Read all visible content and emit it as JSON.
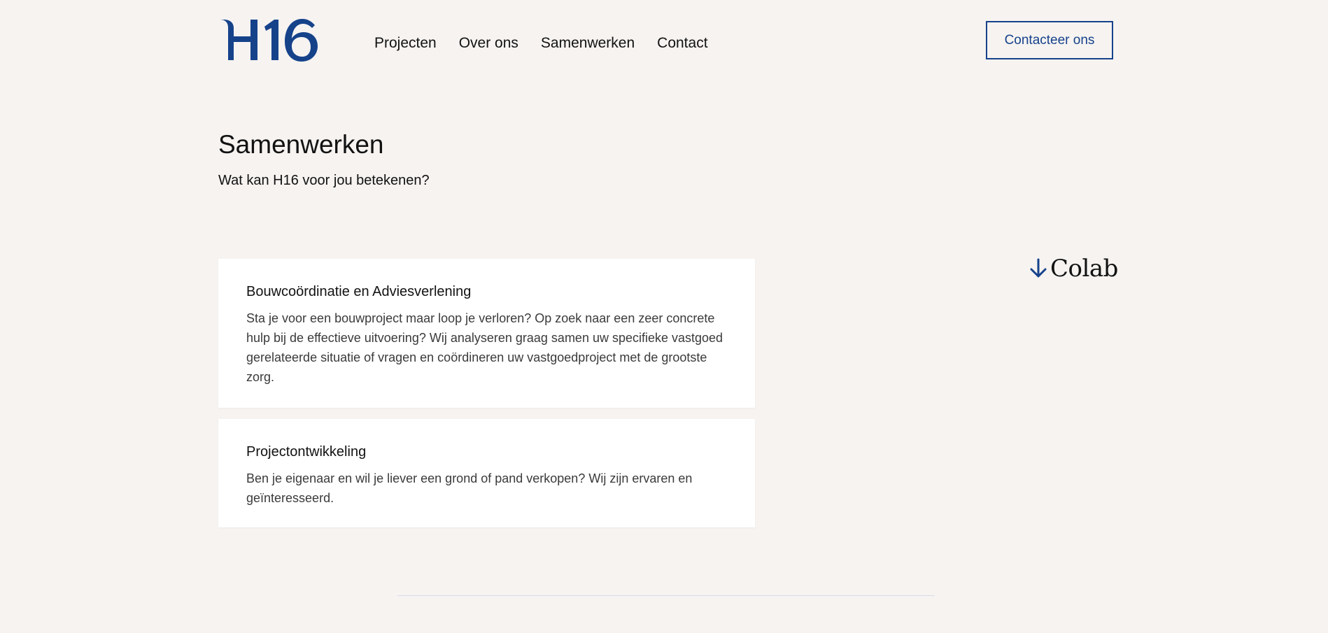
{
  "brand": {
    "logo_text": "H16",
    "accent": "#16428a"
  },
  "nav": {
    "items": [
      {
        "label": "Projecten"
      },
      {
        "label": "Over ons"
      },
      {
        "label": "Samenwerken"
      },
      {
        "label": "Contact"
      }
    ],
    "cta_label": "Contacteer ons"
  },
  "hero": {
    "title": "Samenwerken",
    "subtitle": "Wat kan H16 voor jou betekenen?"
  },
  "services": [
    {
      "title": "Bouwcoördinatie en Adviesverlening",
      "description": "Sta je voor een bouwproject maar loop je verloren? Op zoek naar een zeer concrete hulp bij de effectieve uitvoering? Wij analyseren graag samen uw specifieke vastgoed gerelateerde situatie of vragen en coördineren uw vastgoedproject met de grootste zorg."
    },
    {
      "title": "Projectontwikkeling",
      "description": "Ben je eigenaar en wil je liever een grond of pand verkopen? Wij zijn ervaren en geïnteresseerd."
    }
  ],
  "colab": {
    "label": "Colab",
    "icon": "arrow-down-icon"
  }
}
